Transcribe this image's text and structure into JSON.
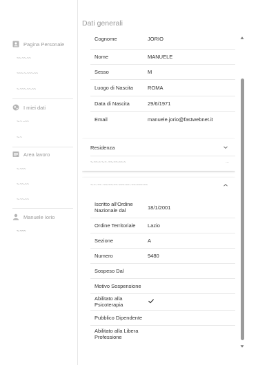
{
  "page_title": "Dati generali",
  "sidebar": {
    "sections": [
      {
        "label": "Pagina Personale",
        "icon": "person-card-icon",
        "links": [
          "~~·~~·~~",
          "~~~·~·~~~·~~",
          "~·~~~·~~·~~"
        ]
      },
      {
        "label": "I miei dati",
        "icon": "globe-icon",
        "links": [
          "~·~ ··~~",
          "~·~"
        ]
      },
      {
        "label": "Area lavoro",
        "icon": "document-list-icon",
        "links": [
          "~·~~~",
          "~·~~·~~",
          "~·~~·~~"
        ]
      },
      {
        "label": "Manuele Iorio",
        "icon": "person-icon",
        "links": [
          "~·~~~"
        ]
      }
    ]
  },
  "personal": {
    "rows": [
      {
        "label": "Cognome",
        "value": "JORIO"
      },
      {
        "label": "Nome",
        "value": "MANUELE"
      },
      {
        "label": "Sesso",
        "value": "M"
      },
      {
        "label": "Luogo di Nascita",
        "value": "ROMA"
      },
      {
        "label": "Data di Nascita",
        "value": "29/6/1971"
      },
      {
        "label": "Email",
        "value": "manuele.jorio@fastwebnet.it"
      }
    ]
  },
  "residenza": {
    "title": "Residenza",
    "placeholder": "~·~~·~ ~·~ ·~~·~~·~~·~"
  },
  "ordine": {
    "title": "~·~· ~~ ·~~·~~·~~ ~~~·~~ ·~~·~~~·~~",
    "rows": [
      {
        "label": "Iscritto all'Ordine Nazionale dal",
        "value": "18/1/2001"
      },
      {
        "label": "Ordine Territoriale",
        "value": "Lazio"
      },
      {
        "label": "Sezione",
        "value": "A"
      },
      {
        "label": "Numero",
        "value": "9480"
      },
      {
        "label": "Sospeso Dal",
        "value": ""
      },
      {
        "label": "Motivo Sospensione",
        "value": ""
      },
      {
        "label": "Abilitato alla Psicoterapia",
        "value": "",
        "checked": true
      },
      {
        "label": "Pubblico Dipendente",
        "value": ""
      },
      {
        "label": "Abilitato alla Libera Professione",
        "value": ""
      }
    ]
  }
}
